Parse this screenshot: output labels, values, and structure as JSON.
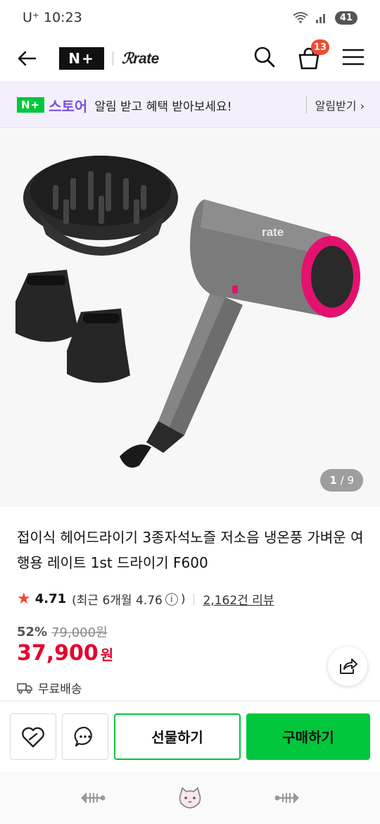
{
  "status_bar": {
    "carrier": "U⁺ 10:23",
    "battery": "41"
  },
  "header": {
    "logo_nplus": "N+",
    "brand": "rate",
    "cart_count": "13"
  },
  "promo": {
    "store_badge": "N+",
    "store_name": "스토어",
    "text": "알림 받고 혜택 받아보세요!",
    "action": "알림받기 ›"
  },
  "gallery": {
    "current": "1",
    "total": "/ 9"
  },
  "product": {
    "title": "접이식 헤어드라이기 3종자석노즐 저소음 냉온풍 가벼운 여행용 레이트 1st 드라이기 F600",
    "rating": "4.71",
    "recent_rating": "(최근 6개월 4.76",
    "recent_rating_close": ")",
    "review_count": "2,162건 리뷰",
    "discount": "52%",
    "original_price": "79,000원",
    "price": "37,900",
    "currency": "원",
    "shipping": "무료배송"
  },
  "actions": {
    "gift": "선물하기",
    "buy": "구매하기"
  },
  "colors": {
    "accent_green": "#00c73c",
    "price_red": "#e5002b",
    "promo_purple": "#7a4fe0"
  }
}
